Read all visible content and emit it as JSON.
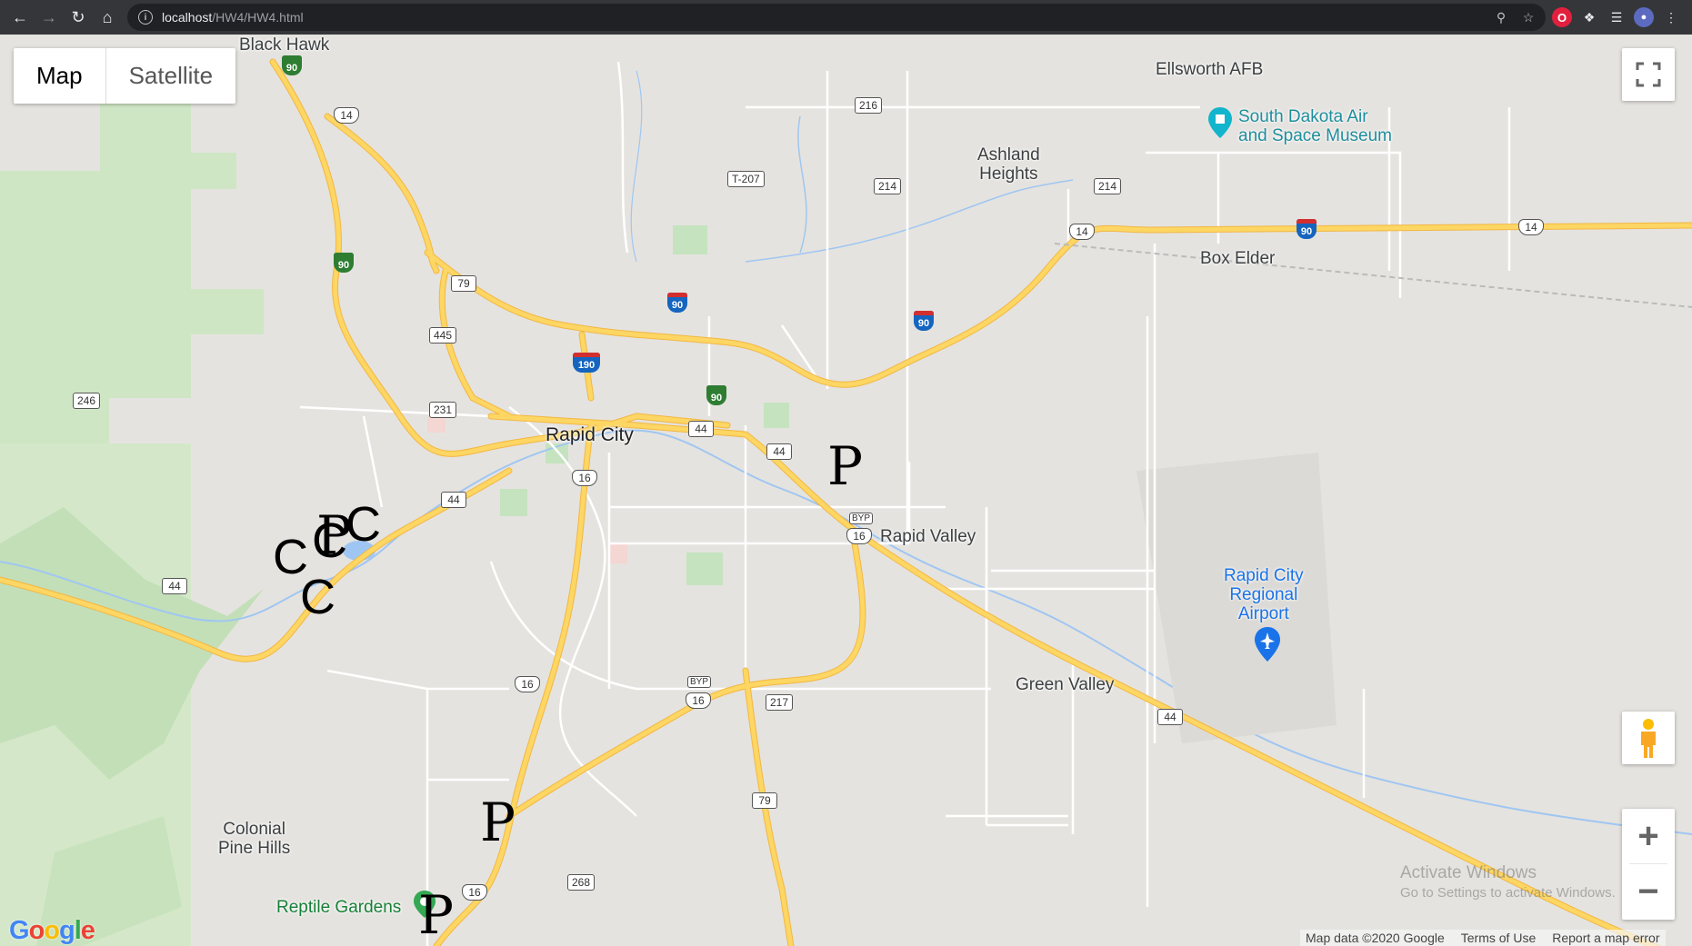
{
  "browser": {
    "url_host": "localhost",
    "url_path": "/HW4/HW4.html"
  },
  "map_type": {
    "map_label": "Map",
    "satellite_label": "Satellite",
    "selected": "Map"
  },
  "places": {
    "black_hawk": "Black Hawk",
    "ellsworth": "Ellsworth AFB",
    "museum_line1": "South Dakota Air",
    "museum_line2": "and Space Museum",
    "ashland_line1": "Ashland",
    "ashland_line2": "Heights",
    "box_elder": "Box Elder",
    "rapid_city": "Rapid City",
    "rapid_valley": "Rapid Valley",
    "airport_line1": "Rapid City",
    "airport_line2": "Regional",
    "airport_line3": "Airport",
    "green_valley": "Green Valley",
    "colonial_line1": "Colonial",
    "colonial_line2": "Pine Hills",
    "reptile_gardens": "Reptile Gardens"
  },
  "shields": {
    "s216": "216",
    "t207": "T-207",
    "s214a": "214",
    "s214b": "214",
    "s14a": "14",
    "s14b": "14",
    "s14c": "14",
    "s79a": "79",
    "s79b": "79",
    "s445": "445",
    "s246": "246",
    "s231": "231",
    "s44a": "44",
    "s44b": "44",
    "s44c": "44",
    "s44d": "44",
    "s44e": "44",
    "s16a": "16",
    "s16b": "16",
    "s16c": "16",
    "s16d": "16",
    "s16e": "16",
    "byp1": "BYP",
    "byp2": "BYP",
    "s217": "217",
    "s268": "268",
    "i90a": "90",
    "i90b": "90",
    "i90c": "90",
    "i190": "190",
    "bl90a": "90",
    "bl90b": "90",
    "bl90c": "90"
  },
  "markers": {
    "p1": "P",
    "p2": "P",
    "p3": "P",
    "p4": "P",
    "c1": "C",
    "c2": "C",
    "c3": "C",
    "c4": "C"
  },
  "footer": {
    "map_data": "Map data ©2020 Google",
    "terms": "Terms of Use",
    "report": "Report a map error"
  },
  "watermark": {
    "line1": "Activate Windows",
    "line2": "Go to Settings to activate Windows."
  },
  "google_logo": "Google",
  "colors": {
    "road_major": "#fdd663",
    "road_outline": "#f2b743",
    "land": "#e5e3df",
    "park": "#c5e3bf",
    "water": "#9fc6f2"
  }
}
